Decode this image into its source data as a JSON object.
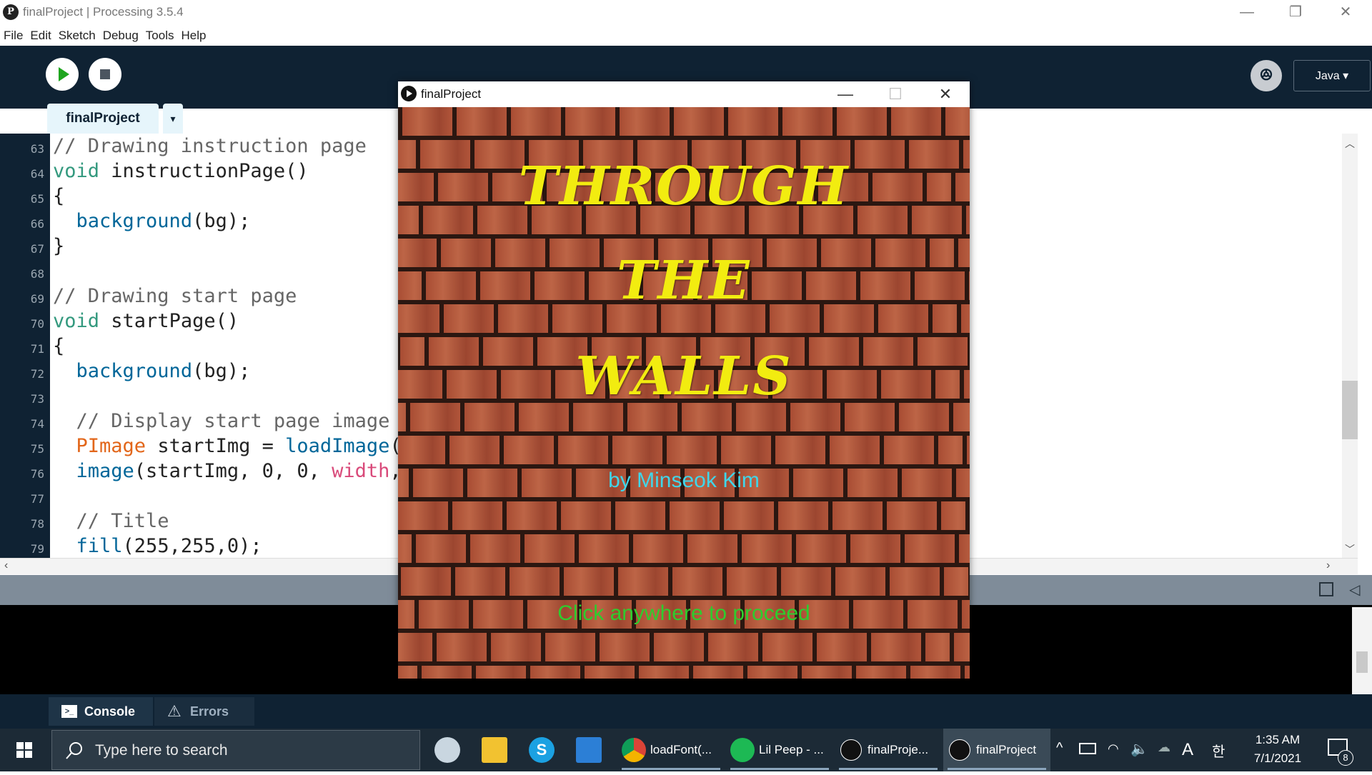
{
  "window": {
    "title": "finalProject | Processing 3.5.4",
    "controls": [
      "—",
      "❐",
      "✕"
    ]
  },
  "menu": [
    "File",
    "Edit",
    "Sketch",
    "Debug",
    "Tools",
    "Help"
  ],
  "toolbar": {
    "mode": "Java ▾",
    "debug_glyph": "ꔮ"
  },
  "tabs": {
    "active": "finalProject",
    "menu_glyph": "▾"
  },
  "editor": {
    "lines": [
      {
        "n": "63",
        "code": "// Drawing instruction page"
      },
      {
        "n": "64",
        "code": "void instructionPage()"
      },
      {
        "n": "65",
        "code": "{"
      },
      {
        "n": "66",
        "code": "  background(bg);"
      },
      {
        "n": "67",
        "code": "}"
      },
      {
        "n": "68",
        "code": ""
      },
      {
        "n": "69",
        "code": "// Drawing start page"
      },
      {
        "n": "70",
        "code": "void startPage()"
      },
      {
        "n": "71",
        "code": "{"
      },
      {
        "n": "72",
        "code": "  background(bg);"
      },
      {
        "n": "73",
        "code": ""
      },
      {
        "n": "74",
        "code": "  // Display start page image"
      },
      {
        "n": "75",
        "code": "  PImage startImg = loadImage("
      },
      {
        "n": "76",
        "code": "  image(startImg, 0, 0, width,"
      },
      {
        "n": "77",
        "code": ""
      },
      {
        "n": "78",
        "code": "  // Title"
      },
      {
        "n": "79",
        "code": "  fill(255,255,0);"
      }
    ]
  },
  "console_tabs": {
    "console": "Console",
    "errors": "Errors"
  },
  "sketch": {
    "title": "finalProject",
    "controls": [
      "—",
      "☐",
      "✕"
    ],
    "game_title": [
      "THROUGH",
      "THE",
      "WALLS"
    ],
    "byline": "by Minseok Kim",
    "prompt": "Click anywhere to proceed"
  },
  "taskbar": {
    "search_placeholder": "Type here to search",
    "apps": [
      {
        "label": "loadFont(..."
      },
      {
        "label": "Lil Peep - ..."
      },
      {
        "label": "finalProje..."
      },
      {
        "label": "finalProject"
      }
    ],
    "time": "1:35 AM",
    "date": "7/1/2021",
    "notification_count": "8",
    "ime": "A",
    "ime2": "한"
  },
  "colors": {
    "ide_dark": "#0f2233",
    "title_yellow": "#f2ec10",
    "byline_cyan": "#3fd6ea",
    "prompt_green": "#2ecc2e"
  }
}
